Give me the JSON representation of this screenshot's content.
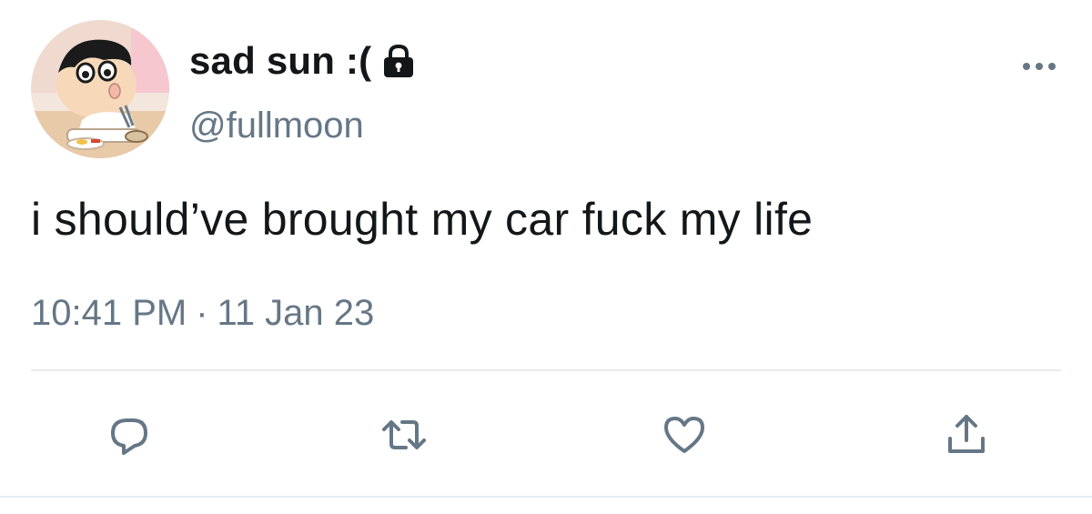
{
  "user": {
    "display_name": "sad sun :(",
    "handle": "@fullmoon",
    "protected": true
  },
  "tweet": {
    "text": "i should’ve brought my car fuck my life",
    "time": "10:41 PM",
    "separator": "·",
    "date": "11 Jan 23"
  },
  "icons": {
    "lock": "lock-icon",
    "more": "more-icon",
    "reply": "reply-icon",
    "retweet": "retweet-icon",
    "like": "heart-icon",
    "share": "share-icon"
  },
  "colors": {
    "text": "#14171a",
    "secondary": "#657786",
    "icon": "#657786",
    "divider": "#e6ecf0"
  }
}
